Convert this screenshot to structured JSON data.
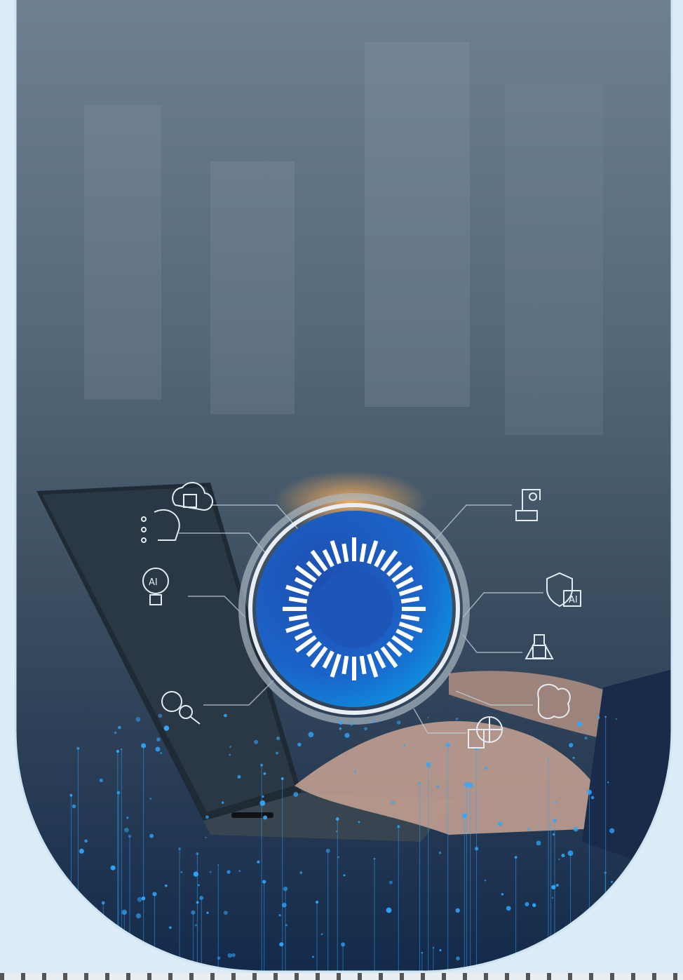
{
  "hero": {
    "icons": [
      "cloud-chip-icon",
      "ai-head-icon",
      "ai-bulb-icon",
      "gear-search-icon",
      "robot-arm-icon",
      "ai-shield-icon",
      "chip-flask-icon",
      "brain-circuit-icon",
      "globe-server-icon"
    ],
    "badge_label": "AI",
    "colors": {
      "frame": "#dcecf6",
      "center": "#1e56b8",
      "center_edge": "#0a8ee0",
      "particles": "#2ea8ff"
    }
  }
}
